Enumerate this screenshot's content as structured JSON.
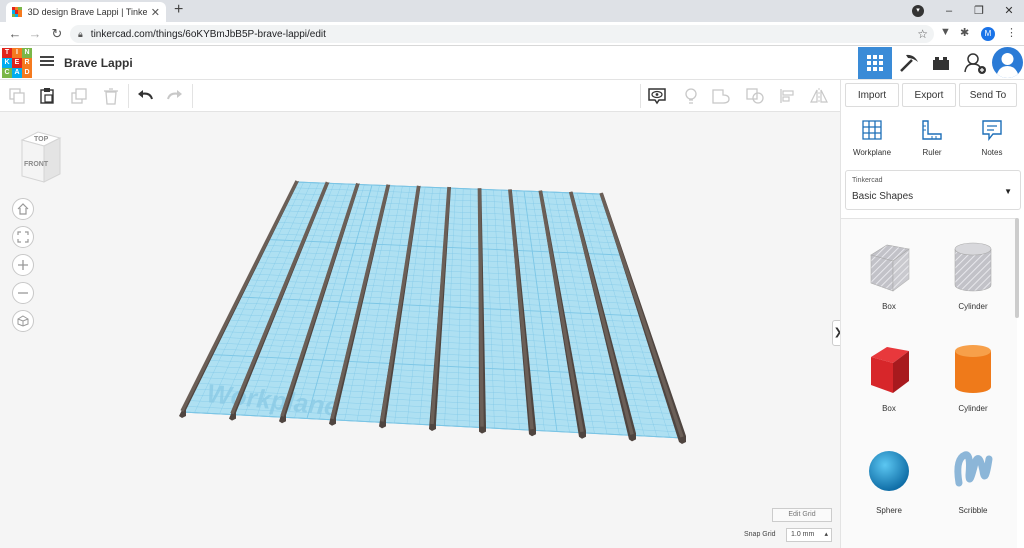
{
  "browser": {
    "tab_title": "3D design Brave Lappi | Tinkercad",
    "tab_close": "✕",
    "new_tab": "+",
    "url": "tinkercad.com/things/6oKYBmJbB5P-brave-lappi/edit",
    "profile_initial": "M",
    "window_buttons": [
      "–",
      "❐",
      "✕"
    ]
  },
  "app": {
    "logo_letters": [
      "T",
      "I",
      "N",
      "K",
      "E",
      "R",
      "C",
      "A",
      "D"
    ],
    "logo_colors": [
      "#e2241b",
      "#f57a1f",
      "#7ab648",
      "#00aeef",
      "#e2241b",
      "#f57a1f",
      "#7ab648",
      "#00aeef",
      "#f57a1f"
    ],
    "design_title": "Brave Lappi"
  },
  "right_panel": {
    "tabs": [
      "Import",
      "Export",
      "Send To"
    ],
    "tools": [
      "Workplane",
      "Ruler",
      "Notes"
    ],
    "library_source": "Tinkercad",
    "library_name": "Basic Shapes",
    "shapes": [
      {
        "name": "Box",
        "color": "#b8b8c0"
      },
      {
        "name": "Cylinder",
        "color": "#b8b8c0"
      },
      {
        "name": "Box",
        "color": "#d7262a"
      },
      {
        "name": "Cylinder",
        "color": "#ef7a1a"
      },
      {
        "name": "Sphere",
        "color": "#1a8fc9"
      },
      {
        "name": "Scribble",
        "color": "#8cb6d8"
      }
    ]
  },
  "canvas": {
    "viewcube_top": "TOP",
    "viewcube_front": "FRONT",
    "workplane_label": "Workplane",
    "edit_grid": "Edit Grid",
    "snap_grid_label": "Snap Grid",
    "snap_grid_value": "1.0 mm",
    "rails": 11
  },
  "colors": {
    "accent": "#3a8bd7",
    "workplane": "#aee0f2",
    "grid": "#7cc6e6",
    "rail": "#6b5f57"
  }
}
